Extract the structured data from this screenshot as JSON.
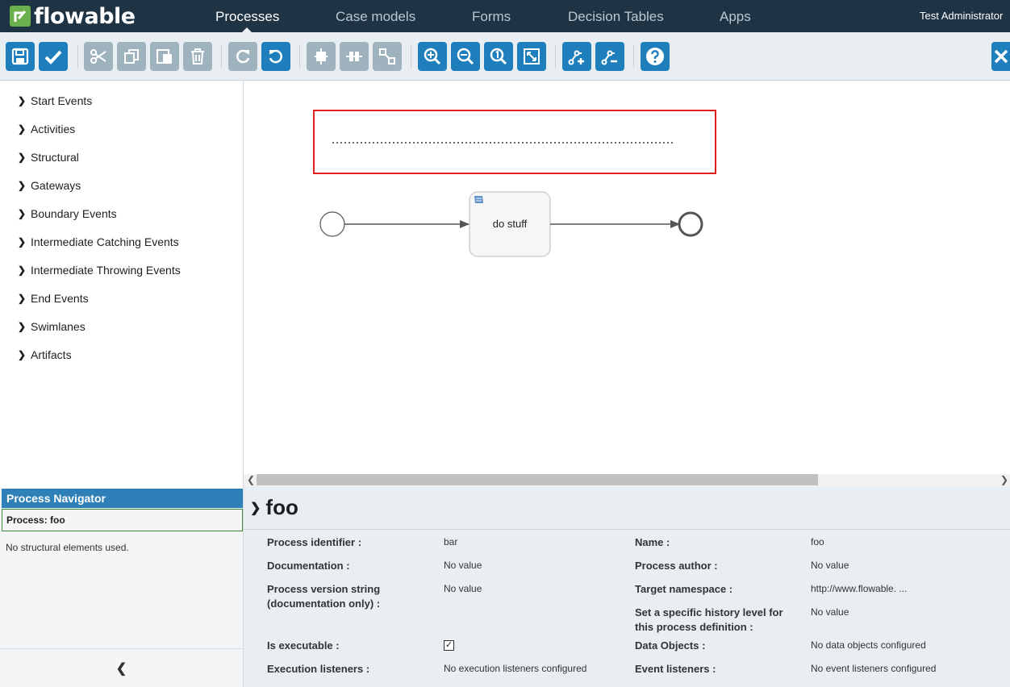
{
  "header": {
    "logo_text": "flowable",
    "nav": [
      "Processes",
      "Case models",
      "Forms",
      "Decision Tables",
      "Apps"
    ],
    "active_nav": "Processes",
    "user": "Test Administrator"
  },
  "toolbar": {
    "buttons": [
      "save-icon",
      "validate-icon",
      "cut-icon",
      "copy-icon",
      "paste-icon",
      "delete-icon",
      "redo-icon",
      "undo-icon",
      "align-horizontal-icon",
      "align-vertical-icon",
      "same-size-icon",
      "zoom-in-icon",
      "zoom-out-icon",
      "zoom-actual-icon",
      "zoom-fit-icon",
      "add-bendpoint-icon",
      "remove-bendpoint-icon",
      "help-icon",
      "close-icon"
    ]
  },
  "palette": {
    "items": [
      "Start Events",
      "Activities",
      "Structural",
      "Gateways",
      "Boundary Events",
      "Intermediate Catching Events",
      "Intermediate Throwing Events",
      "End Events",
      "Swimlanes",
      "Artifacts"
    ]
  },
  "navigator": {
    "title": "Process Navigator",
    "process": "Process: foo",
    "empty": "No structural elements used."
  },
  "diagram": {
    "task_label": "do stuff"
  },
  "properties": {
    "title": "foo",
    "left": [
      {
        "label": "Process identifier :",
        "value": "bar"
      },
      {
        "label": "Documentation :",
        "value": "No value"
      },
      {
        "label": "Process version string (documentation only) :",
        "value": "No value"
      },
      {
        "label": "Is executable :",
        "value": "checked"
      },
      {
        "label": "Execution listeners :",
        "value": "No execution listeners configured"
      }
    ],
    "right": [
      {
        "label": "Name :",
        "value": "foo"
      },
      {
        "label": "Process author :",
        "value": "No value"
      },
      {
        "label": "Target namespace :",
        "value": "http://www.flowable. ..."
      },
      {
        "label": "Set a specific history level for this process definition :",
        "value": "No value"
      },
      {
        "label": "Data Objects :",
        "value": "No data objects configured"
      },
      {
        "label": "Event listeners :",
        "value": "No event listeners configured"
      }
    ]
  },
  "colors": {
    "header": "#1e3344",
    "toolbar_blue": "#1f7fbd",
    "accent_green": "#6ab04c",
    "selection_red": "#e02020"
  }
}
